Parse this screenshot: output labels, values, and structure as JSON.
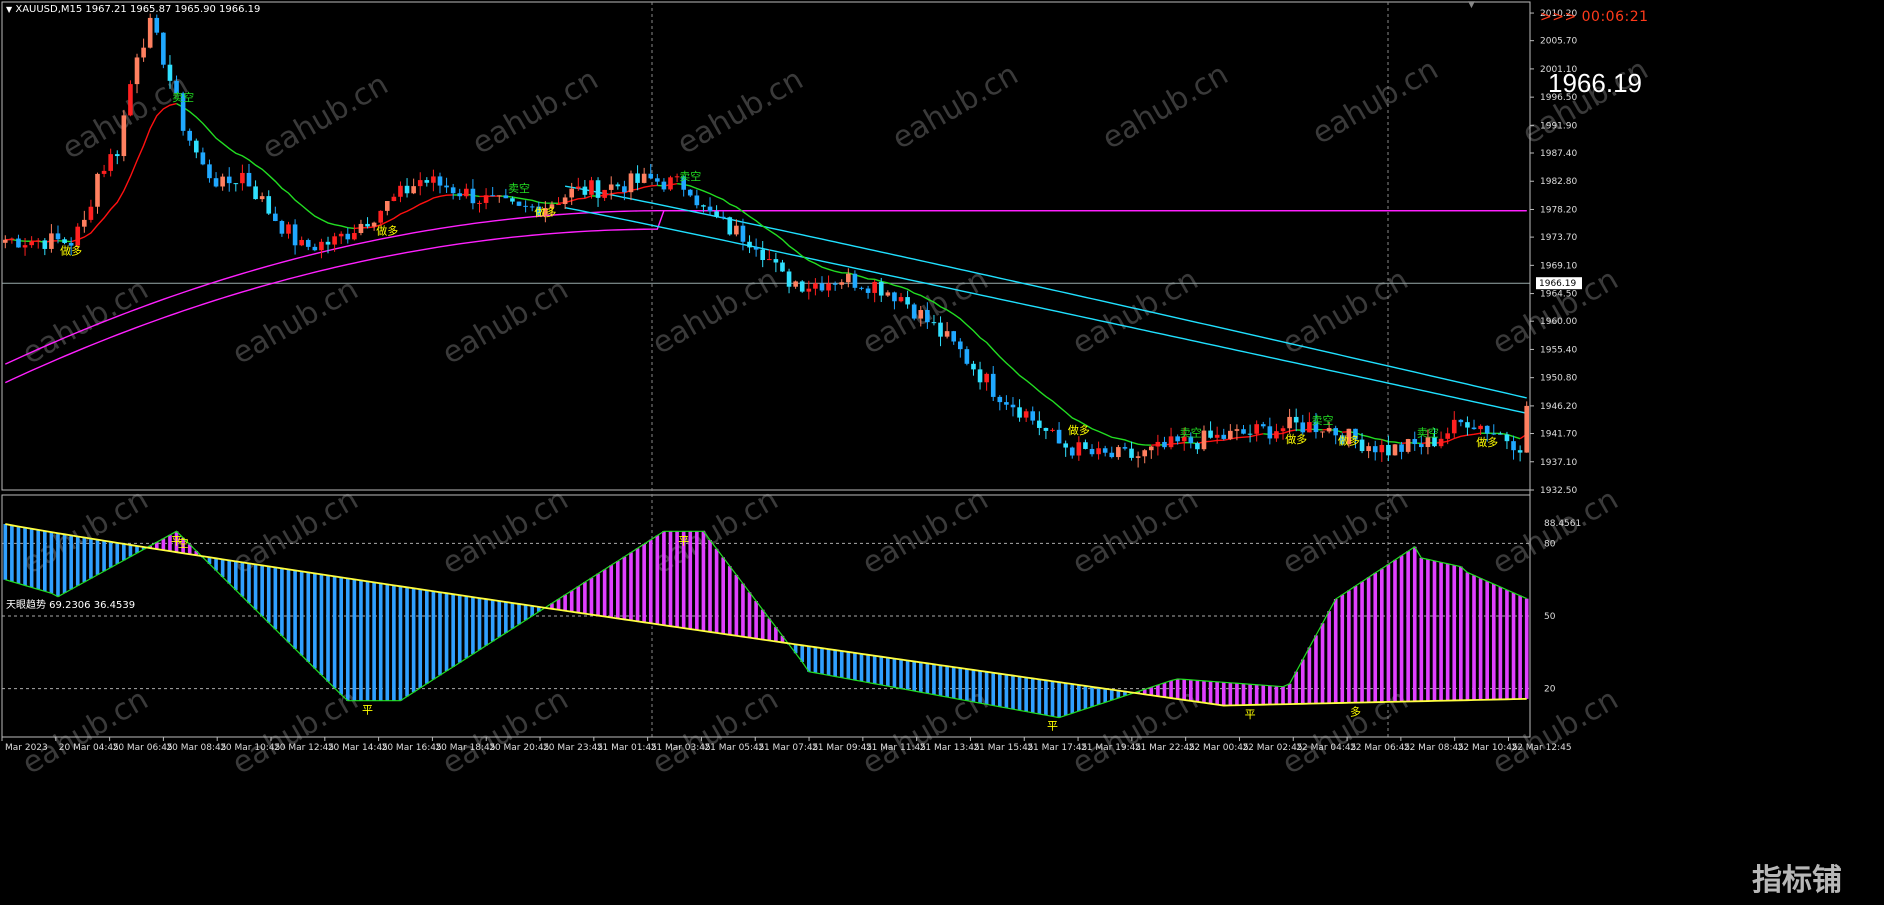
{
  "window": {
    "symbol_header": "XAUUSD,M15  1967.21 1965.87 1965.90 1966.19",
    "timer": ">>> 00:06:21",
    "big_price": "1966.19",
    "indicator_header": "天眼趋势 69.2306 36.4539"
  },
  "colors": {
    "background": "#000000",
    "bull_candle": "#ff2020",
    "bull_candle_light": "#ff8060",
    "bear_candle": "#20a8ff",
    "bear_candle_light": "#30e0ff",
    "ma_red": "#ff1010",
    "ma_green": "#22dd22",
    "ma_magenta": "#ff20ff",
    "ma_cyan": "#20e0ff",
    "signal_sell": "#22dd22",
    "signal_buy": "#ffff00",
    "ind_yellow": "#ffff40",
    "ind_bull_hist": "#e040ff",
    "ind_bear_hist": "#30a0ff"
  },
  "main_chart": {
    "price_axis": [
      "2010.20",
      "2005.70",
      "2001.10",
      "1996.50",
      "1991.90",
      "1987.40",
      "1982.80",
      "1978.20",
      "1973.70",
      "1969.10",
      "1964.50",
      "1960.00",
      "1955.40",
      "1950.80",
      "1946.20",
      "1941.70",
      "1937.10",
      "1932.50"
    ],
    "current_price_label": "1966.19",
    "price_range": [
      1932.5,
      2012.0
    ],
    "signals": [
      {
        "text": "做多",
        "bar": 10,
        "type": "buy"
      },
      {
        "text": "卖空",
        "bar": 27,
        "type": "sell"
      },
      {
        "text": "做多",
        "bar": 58,
        "type": "buy"
      },
      {
        "text": "卖空",
        "bar": 78,
        "type": "sell"
      },
      {
        "text": "做多",
        "bar": 82,
        "type": "buy"
      },
      {
        "text": "卖空",
        "bar": 104,
        "type": "sell"
      },
      {
        "text": "做多",
        "bar": 163,
        "type": "buy"
      },
      {
        "text": "卖空",
        "bar": 180,
        "type": "sell"
      },
      {
        "text": "做多",
        "bar": 196,
        "type": "buy"
      },
      {
        "text": "卖空",
        "bar": 200,
        "type": "sell"
      },
      {
        "text": "做多",
        "bar": 204,
        "type": "buy"
      },
      {
        "text": "卖空",
        "bar": 216,
        "type": "sell"
      },
      {
        "text": "做多",
        "bar": 225,
        "type": "buy"
      }
    ]
  },
  "indicator": {
    "scale_labels": [
      "88.4561",
      "80",
      "50",
      "20"
    ],
    "levels": [
      80,
      50,
      20
    ],
    "markers": [
      {
        "text": "空",
        "bar": 27,
        "level": "top"
      },
      {
        "text": "平",
        "bar": 26,
        "level": "top2"
      },
      {
        "text": "平",
        "bar": 55,
        "level": "bottom"
      },
      {
        "text": "平",
        "bar": 103,
        "level": "top2"
      },
      {
        "text": "平",
        "bar": 159,
        "level": "bottom2"
      },
      {
        "text": "平",
        "bar": 189,
        "level": "bottom"
      },
      {
        "text": "多",
        "bar": 205,
        "level": "bottom2"
      }
    ]
  },
  "time_axis": [
    "Mar 2023",
    "20 Mar 04:45",
    "20 Mar 06:45",
    "20 Mar 08:45",
    "20 Mar 10:45",
    "20 Mar 12:45",
    "20 Mar 14:45",
    "20 Mar 16:45",
    "20 Mar 18:45",
    "20 Mar 20:45",
    "20 Mar 23:45",
    "21 Mar 01:45",
    "21 Mar 03:45",
    "21 Mar 05:45",
    "21 Mar 07:45",
    "21 Mar 09:45",
    "21 Mar 11:45",
    "21 Mar 13:45",
    "21 Mar 15:45",
    "21 Mar 17:45",
    "21 Mar 19:45",
    "21 Mar 22:45",
    "22 Mar 00:45",
    "22 Mar 02:45",
    "22 Mar 04:45",
    "22 Mar 06:45",
    "22 Mar 08:45",
    "22 Mar 10:45",
    "22 Mar 12:45"
  ],
  "watermark": {
    "text": "eahub.cn",
    "corner": "指标铺"
  }
}
